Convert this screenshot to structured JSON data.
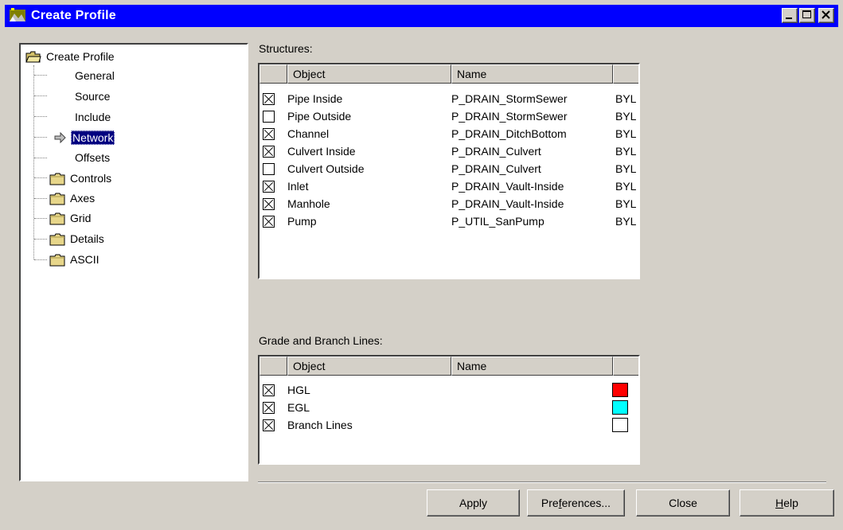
{
  "window": {
    "title": "Create Profile"
  },
  "tree": {
    "root": "Create Profile",
    "children": [
      {
        "label": "General",
        "kind": "item"
      },
      {
        "label": "Source",
        "kind": "item"
      },
      {
        "label": "Include",
        "kind": "item"
      },
      {
        "label": "Network",
        "kind": "item",
        "selected": true
      },
      {
        "label": "Offsets",
        "kind": "item"
      },
      {
        "label": "Controls",
        "kind": "folder"
      },
      {
        "label": "Axes",
        "kind": "folder"
      },
      {
        "label": "Grid",
        "kind": "folder"
      },
      {
        "label": "Details",
        "kind": "folder"
      },
      {
        "label": "ASCII",
        "kind": "folder"
      }
    ]
  },
  "structures": {
    "label": "Structures:",
    "columns": [
      "Object",
      "Name",
      ""
    ],
    "rows": [
      {
        "checked": true,
        "object": "Pipe Inside",
        "name": "P_DRAIN_StormSewer",
        "extra": "BYL"
      },
      {
        "checked": false,
        "object": "Pipe Outside",
        "name": "P_DRAIN_StormSewer",
        "extra": "BYL"
      },
      {
        "checked": true,
        "object": "Channel",
        "name": "P_DRAIN_DitchBottom",
        "extra": "BYL"
      },
      {
        "checked": true,
        "object": "Culvert Inside",
        "name": "P_DRAIN_Culvert",
        "extra": "BYL"
      },
      {
        "checked": false,
        "object": "Culvert Outside",
        "name": "P_DRAIN_Culvert",
        "extra": "BYL"
      },
      {
        "checked": true,
        "object": "Inlet",
        "name": "P_DRAIN_Vault-Inside",
        "extra": "BYL"
      },
      {
        "checked": true,
        "object": "Manhole",
        "name": "P_DRAIN_Vault-Inside",
        "extra": "BYL"
      },
      {
        "checked": true,
        "object": "Pump",
        "name": "P_UTIL_SanPump",
        "extra": "BYL"
      }
    ]
  },
  "grade": {
    "label": "Grade and Branch Lines:",
    "columns": [
      "Object",
      "Name",
      ""
    ],
    "rows": [
      {
        "checked": true,
        "object": "HGL",
        "name": "",
        "color": "#ff0000"
      },
      {
        "checked": true,
        "object": "EGL",
        "name": "",
        "color": "#00ffff"
      },
      {
        "checked": true,
        "object": "Branch Lines",
        "name": "",
        "color": "#ffffff"
      }
    ]
  },
  "buttons": {
    "apply": "Apply",
    "preferences_pre": "Pre",
    "preferences_u": "f",
    "preferences_post": "erences...",
    "close": "Close",
    "help_u": "H",
    "help_post": "elp"
  }
}
